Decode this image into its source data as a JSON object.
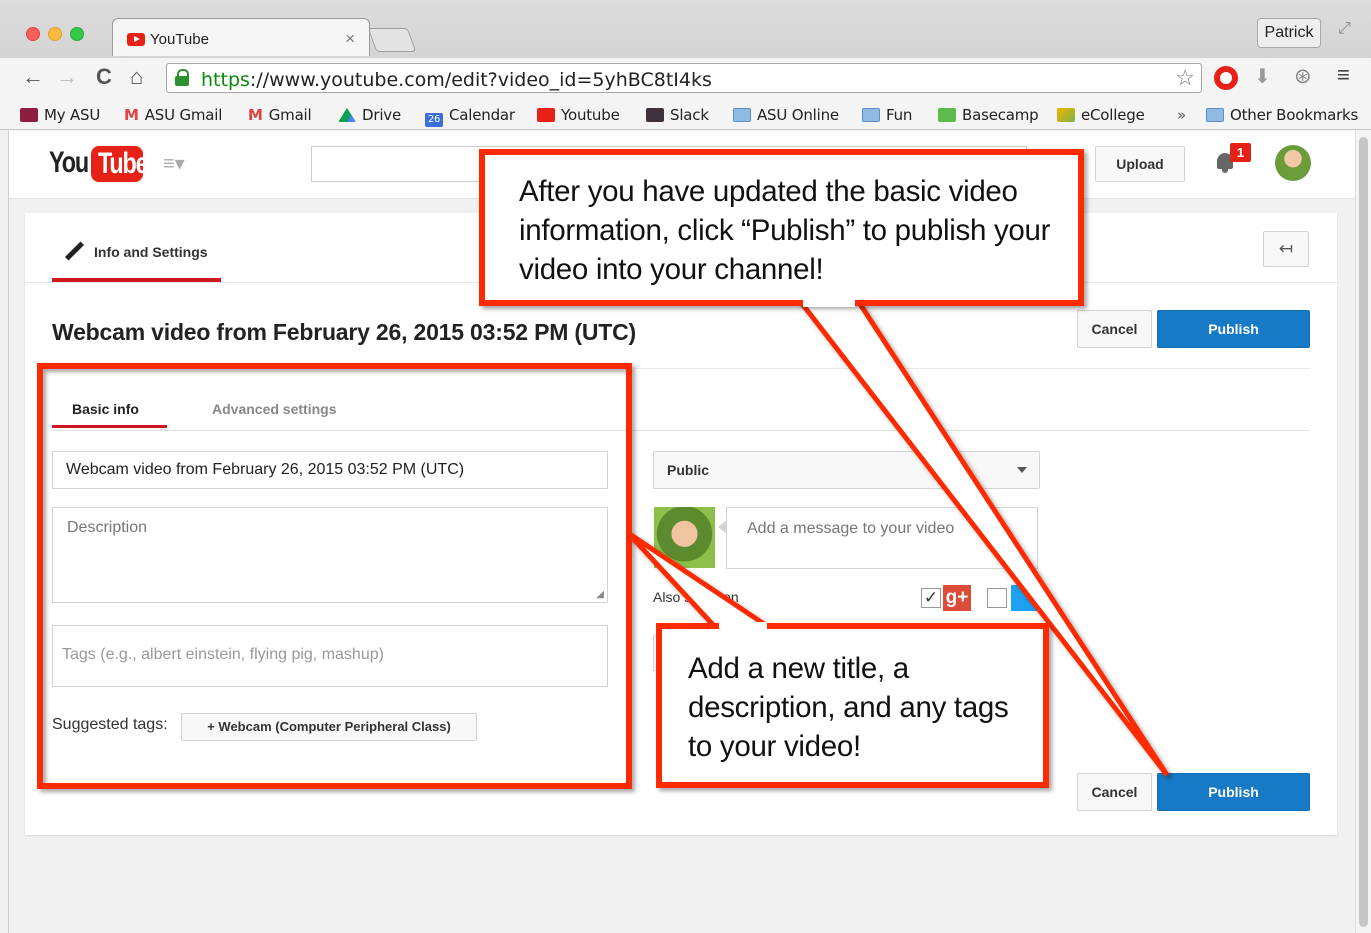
{
  "browser": {
    "tab_title": "YouTube",
    "tab_close": "×",
    "profile_name": "Patrick",
    "url_scheme": "https",
    "url_rest": "://www.youtube.com/edit?video_id=5yhBC8tI4ks",
    "bookmarks": [
      {
        "label": "My ASU",
        "icon": "asu-icon"
      },
      {
        "label": "ASU Gmail",
        "icon": "gmail-icon"
      },
      {
        "label": "Gmail",
        "icon": "gmail-icon"
      },
      {
        "label": "Drive",
        "icon": "drive-icon"
      },
      {
        "label": "Calendar",
        "icon": "calendar-icon"
      },
      {
        "label": "Youtube",
        "icon": "youtube-icon"
      },
      {
        "label": "Slack",
        "icon": "slack-icon"
      },
      {
        "label": "ASU Online",
        "icon": "folder-icon"
      },
      {
        "label": "Fun",
        "icon": "folder-icon"
      },
      {
        "label": "Basecamp",
        "icon": "basecamp-icon"
      },
      {
        "label": "eCollege",
        "icon": "ecollege-icon"
      }
    ],
    "bookmarks_overflow": "»",
    "other_bookmarks": "Other Bookmarks",
    "calendar_day": "26"
  },
  "masthead": {
    "logo_you": "You",
    "logo_tube": "Tube",
    "upload_label": "Upload",
    "notification_count": "1"
  },
  "editor": {
    "tab_info_label": "Info and Settings",
    "back_arrow": "↤",
    "video_title": "Webcam video from February 26, 2015 03:52 PM (UTC)",
    "cancel_label": "Cancel",
    "publish_label": "Publish",
    "subtab_basic": "Basic info",
    "subtab_advanced": "Advanced settings",
    "title_value": "Webcam video from February 26, 2015 03:52 PM (UTC)",
    "description_placeholder": "Description",
    "tags_placeholder": "Tags (e.g., albert einstein, flying pig, mashup)",
    "suggested_label": "Suggested tags:",
    "suggested_tag": "+ Webcam (Computer Peripheral Class)",
    "privacy_value": "Public",
    "message_placeholder": "Add a message to your video",
    "also_share_label": "Also share on",
    "gplus_label": "g+"
  },
  "annotations": {
    "callout1": "After you have updated the basic video information, click “Publish” to publish your video into your channel!",
    "callout2": "Add a new title, a description, and any tags to your video!",
    "color": "#ff2a00"
  }
}
